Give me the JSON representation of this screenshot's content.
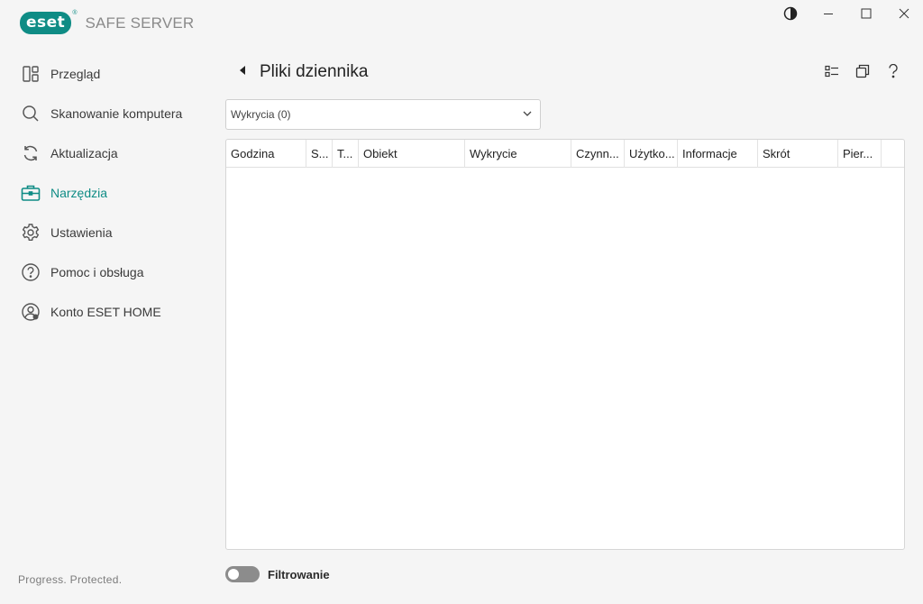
{
  "app": {
    "brand": "eset",
    "product": "SAFE SERVER",
    "tagline": "Progress. Protected.",
    "accent_color": "#0f8c85"
  },
  "window_controls": [
    {
      "name": "theme-toggle",
      "icon": "half-circle-icon"
    },
    {
      "name": "minimize",
      "icon": "minimize-icon"
    },
    {
      "name": "maximize",
      "icon": "maximize-icon"
    },
    {
      "name": "close",
      "icon": "close-icon"
    }
  ],
  "sidebar": {
    "items": [
      {
        "label": "Przegląd",
        "icon": "dashboard-icon",
        "active": false
      },
      {
        "label": "Skanowanie komputera",
        "icon": "search-icon",
        "active": false
      },
      {
        "label": "Aktualizacja",
        "icon": "refresh-icon",
        "active": false
      },
      {
        "label": "Narzędzia",
        "icon": "briefcase-icon",
        "active": true
      },
      {
        "label": "Ustawienia",
        "icon": "gear-icon",
        "active": false
      },
      {
        "label": "Pomoc i obsługa",
        "icon": "help-icon",
        "active": false
      },
      {
        "label": "Konto ESET HOME",
        "icon": "account-icon",
        "active": false
      }
    ]
  },
  "page": {
    "title": "Pliki dziennika",
    "header_icons": [
      "list-view-icon",
      "copy-window-icon",
      "help-icon"
    ]
  },
  "log_dropdown": {
    "selected": "Wykrycia (0)"
  },
  "table": {
    "columns": [
      "Godzina",
      "S...",
      "T...",
      "Obiekt",
      "Wykrycie",
      "Czynn...",
      "Użytko...",
      "Informacje",
      "Skrót",
      "Pier..."
    ],
    "rows": []
  },
  "filter": {
    "label": "Filtrowanie",
    "enabled": false
  }
}
